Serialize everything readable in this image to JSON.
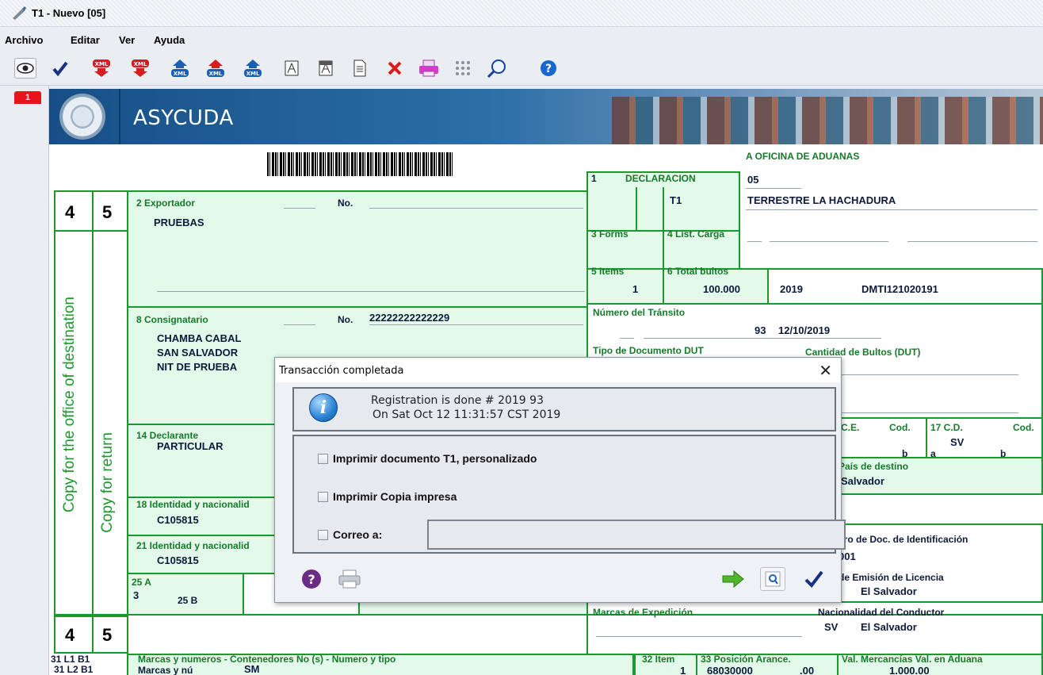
{
  "window": {
    "title": "T1 - Nuevo [05]"
  },
  "menu": {
    "items": [
      "Archivo",
      "Editar",
      "Ver",
      "Ayuda"
    ]
  },
  "toolbar": {
    "buttons": [
      "eye-icon",
      "check-icon",
      "xml-export-icon",
      "xml-export-icon-2",
      "xml-import-icon",
      "xml-import-icon-2",
      "xml-import-icon-3",
      "pdf-icon",
      "pdf-icon-2",
      "document-icon",
      "delete-icon",
      "print-icon",
      "grid-icon",
      "search-icon",
      "help-icon"
    ]
  },
  "page_tab": "1",
  "banner": {
    "brand": "ASYCUDA"
  },
  "form": {
    "office": {
      "label": "A OFICINA DE ADUANAS",
      "code": "05",
      "name": "TERRESTRE LA HACHADURA"
    },
    "declaracion": {
      "label": "DECLARACION",
      "number": "1",
      "type": "T1"
    },
    "forms_label": "3 Forms",
    "list_carga_label": "4 List. Carga",
    "items": {
      "label": "5 Items",
      "value": "1"
    },
    "total_bultos": {
      "label": "6 Total bultos",
      "value": "100.000"
    },
    "year": "2019",
    "reference": "DMTI121020191",
    "numero_transito": {
      "label": "Número del Tránsito",
      "value": "93",
      "date": "12/10/2019"
    },
    "tipo_documento_label": "Tipo de Documento DUT",
    "cantidad_bultos_label": "Cantidad de Bultos (DUT)",
    "exportador": {
      "label": "2 Exportador",
      "no_label": "No.",
      "name": "PRUEBAS"
    },
    "consignatario": {
      "label": "8 Consignatario",
      "no_label": "No.",
      "no_value": "22222222222229",
      "lines": [
        "CHAMBA CABAL",
        "SAN SALVADOR",
        "NIT DE PRUEBA"
      ]
    },
    "declarante": {
      "label": "14 Declarante",
      "name": "PARTICULAR"
    },
    "identidad_18": {
      "label": "18 Identidad y nacionalid",
      "value": "C105815"
    },
    "identidad_21": {
      "label": "21 Identidad y nacionalid",
      "value": "C105815"
    },
    "box_25a": {
      "label": "25 A",
      "value": "3",
      "b_label": "25 B"
    },
    "ce_label": "C.E.",
    "cod_label": "Cod.",
    "cd_label": "17 C.D.",
    "cd_value": "SV",
    "b_mark": "b",
    "a_mark": "a",
    "pais_destino": {
      "label": "País de destino",
      "value": "Salvador"
    },
    "doc_identificacion": {
      "label": "ero de Doc. de Identificación",
      "value": "001"
    },
    "emision_licencia": {
      "label": "de Emisión de Licencia",
      "value": "El Salvador"
    },
    "marcas_expedicion_label": "Marcas de Expedición",
    "nacionalidad_conductor": {
      "label": "Nacionalidad del Conductor",
      "code": "SV",
      "value": "El Salvador"
    },
    "side_numbers": {
      "left": "4",
      "right": "5"
    },
    "copy_destination": "Copy for the office of destination",
    "copy_return": "Copy for return",
    "bottom": {
      "l1b1": "31 L1 B1",
      "l2b1": "31 L2 B1",
      "marcas_label": "Marcas y numeros - Contenedores No (s) - Numero y tipo",
      "marcas_sub": "Marcas y nú",
      "marcas_value": "SM",
      "item_label": "32 Item",
      "item_value": "1",
      "posicion_label": "33 Posición Arance.",
      "posicion_value": "68030000",
      "posicion_suffix": ".00",
      "val_label": "Val. Mercancías Val. en Aduana",
      "val_value": "1.000.00"
    }
  },
  "dialog": {
    "title": "Transacción completada",
    "message_line1": "Registration is done # 2019 93",
    "message_line2": "On  Sat Oct 12 11:31:57 CST 2019",
    "option1": "Imprimir documento T1, personalizado",
    "option2": "Imprimir Copia impresa",
    "option3": "Correo a:",
    "email_value": ""
  },
  "colors": {
    "form_green": "#1a9a2c",
    "field_green": "#e3f9ea",
    "label_green": "#167a2a"
  }
}
